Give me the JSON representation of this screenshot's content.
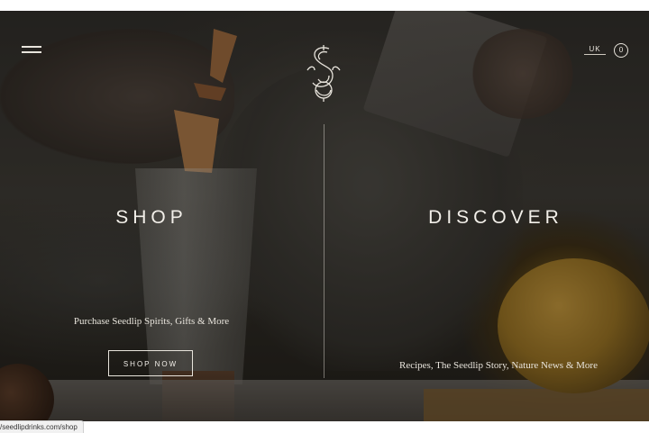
{
  "header": {
    "region_label": "UK",
    "cart_count": "0",
    "logo_icon": "seedlip-monogram-s-icon",
    "menu_icon": "hamburger-menu-icon"
  },
  "shop": {
    "title": "SHOP",
    "subtitle": "Purchase Seedlip Spirits, Gifts & More",
    "button_label": "SHOP NOW"
  },
  "discover": {
    "title": "DISCOVER",
    "subtitle": "Recipes, The Seedlip Story, Nature News & More"
  },
  "status_bar": {
    "url": "/seedlipdrinks.com/shop"
  },
  "colors": {
    "text": "#f2efe9",
    "overlay": "#14120e",
    "accent_orange": "#c89a3a"
  }
}
